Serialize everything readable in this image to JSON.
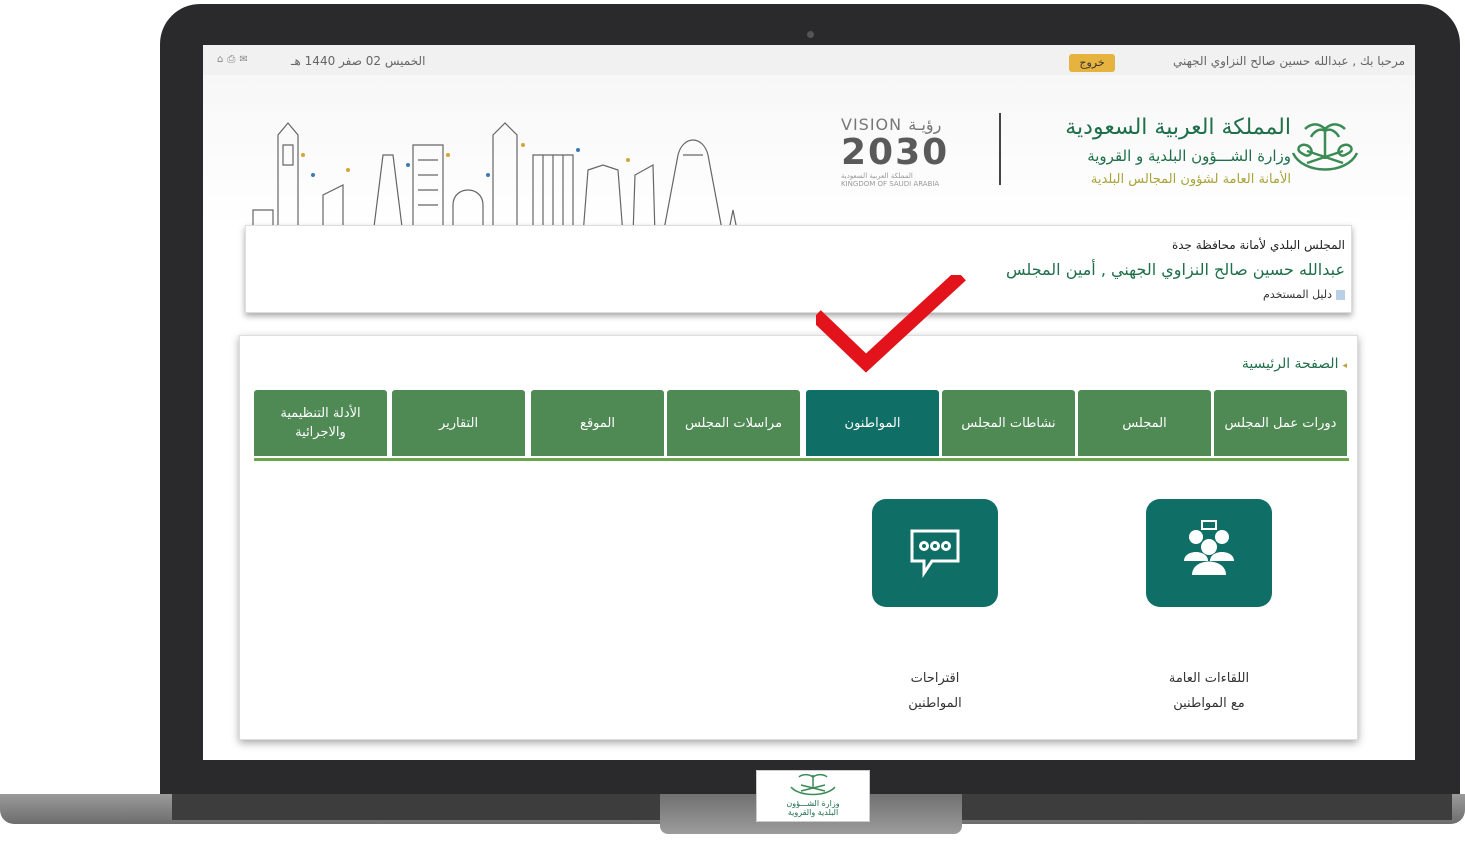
{
  "topbar": {
    "welcome": "مرحبا بك , عبدالله حسين صالح النزاوي الجهني",
    "logout": "خروج",
    "date": "الخميس 02 صفر 1440 هـ",
    "icons": [
      "home-icon",
      "print-icon",
      "mail-icon"
    ]
  },
  "header": {
    "org_title": "المملكة العربية السعودية",
    "ministry": "وزارة الشـــؤون البلدية و القروية",
    "secretariat": "الأمانة العامة لشؤون المجالس البلدية",
    "vision_word": "VISION",
    "vision_ar": "رؤيـة",
    "vision_year": "2030",
    "vision_sub1": "المملكة العربية السعودية",
    "vision_sub2": "KINGDOM OF SAUDI ARABIA"
  },
  "council": {
    "name": "المجلس البلدي لأمانة محافظة جدة",
    "user": "عبدالله حسين صالح النزاوي الجهني , أمين المجلس",
    "guide": "دليل المستخدم"
  },
  "breadcrumb": "الصفحة الرئيسية",
  "tabs": [
    {
      "label": "دورات عمل المجلس",
      "active": false
    },
    {
      "label": "المجلس",
      "active": false
    },
    {
      "label": "نشاطات المجلس",
      "active": false
    },
    {
      "label": "المواطنون",
      "active": true
    },
    {
      "label": "مراسلات المجلس",
      "active": false
    },
    {
      "label": "الموقع",
      "active": false
    },
    {
      "label": "التقارير",
      "active": false
    },
    {
      "label": "الأدلة التنظيمية والاجرائية",
      "active": false
    }
  ],
  "tiles": [
    {
      "label_line1": "اللقاءات العامة",
      "label_line2": "مع المواطنين",
      "icon": "group-icon"
    },
    {
      "label_line1": "اقتراحات",
      "label_line2": "المواطنين",
      "icon": "chat-bubble-icon"
    }
  ],
  "base_logo": {
    "line1": "وزارة الشـــؤون",
    "line2": "البلدية والقروية"
  },
  "colors": {
    "tab_bg": "#4f8a55",
    "tab_active_bg": "#0f6e66",
    "tab_underline": "#6aa74a",
    "brand_green": "#1f6f4a",
    "check_red": "#e3131b",
    "logout_bg": "#e6b33e"
  }
}
